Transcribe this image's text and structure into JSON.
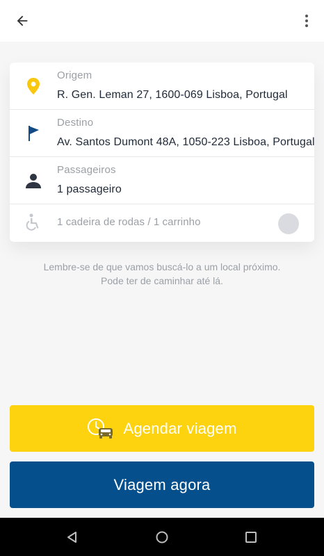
{
  "header": {
    "back_icon": "arrow-left-icon",
    "menu_icon": "more-vertical-icon"
  },
  "trip_form": {
    "origin": {
      "label": "Origem",
      "value": "R. Gen. Leman 27, 1600-069 Lisboa, Portugal",
      "icon": "location-pin-icon"
    },
    "destination": {
      "label": "Destino",
      "value": "Av. Santos Dumont 48A, 1050-223 Lisboa, Portugal",
      "icon": "flag-icon"
    },
    "passengers": {
      "label": "Passageiros",
      "value": "1 passageiro",
      "icon": "person-icon"
    },
    "wheelchair": {
      "value": "1 cadeira de rodas / 1 carrinho",
      "icon": "wheelchair-icon",
      "enabled": false
    }
  },
  "hint": {
    "line1": "Lembre-se de que vamos buscá-lo a um local próximo.",
    "line2": "Pode ter de caminhar até lá."
  },
  "actions": {
    "schedule_label": "Agendar viagem",
    "schedule_icon": "clock-car-icon",
    "now_label": "Viagem agora"
  },
  "colors": {
    "accent_yellow": "#fdd20e",
    "primary_blue": "#064f8d",
    "flag_blue": "#114a84",
    "pin_yellow": "#f9c80e"
  },
  "system_nav": {
    "back_icon": "nav-back-triangle-icon",
    "home_icon": "nav-home-circle-icon",
    "recents_icon": "nav-recents-square-icon"
  }
}
